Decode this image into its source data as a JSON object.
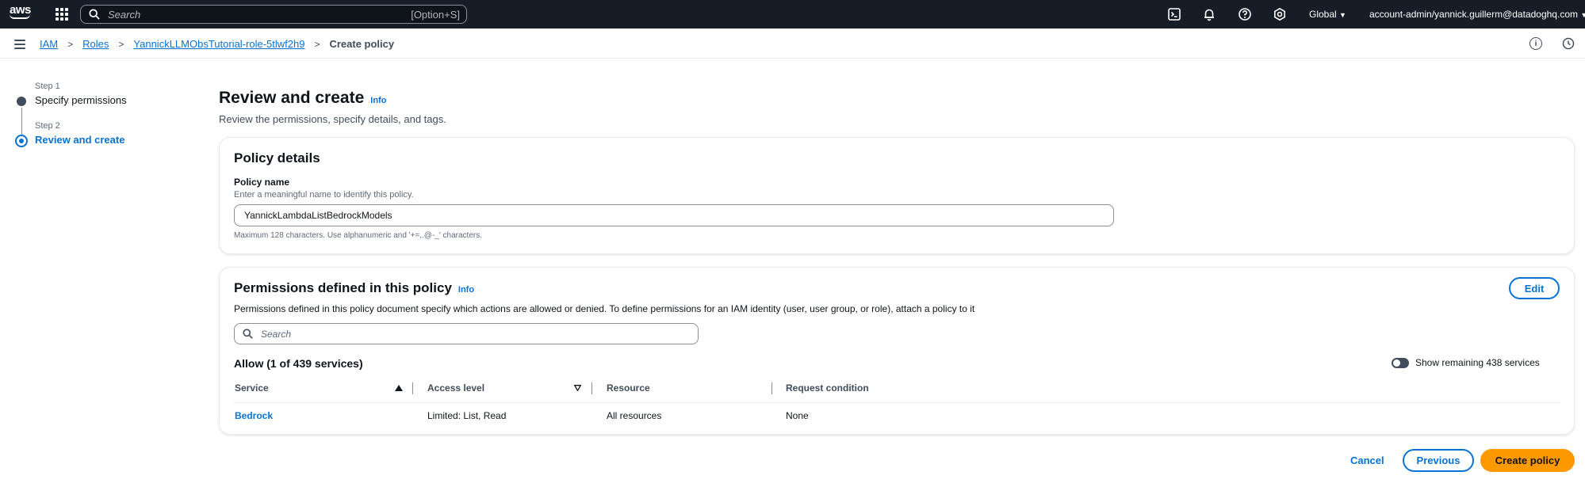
{
  "topnav": {
    "logo_text": "aws",
    "search_placeholder": "Search",
    "search_shortcut": "[Option+S]",
    "region": "Global",
    "region_caret": "▼",
    "account": "account-admin/yannick.guillerm@datadoghq.com",
    "account_caret": "▼",
    "icons": [
      "cloudshell-icon",
      "bell-icon",
      "help-icon",
      "settings-icon"
    ]
  },
  "breadcrumb": {
    "items": [
      "IAM",
      "Roles",
      "YannickLLMObsTutorial-role-5tlwf2h9"
    ],
    "current": "Create policy",
    "separator": ">",
    "right_icons": [
      "info-icon",
      "history-icon"
    ]
  },
  "steps": [
    {
      "step_label": "Step 1",
      "title": "Specify permissions",
      "active": false
    },
    {
      "step_label": "Step 2",
      "title": "Review and create",
      "active": true
    }
  ],
  "main": {
    "title": "Review and create",
    "info": "Info",
    "description": "Review the permissions, specify details, and tags."
  },
  "policy_details": {
    "title": "Policy details",
    "name_label": "Policy name",
    "name_hint": "Enter a meaningful name to identify this policy.",
    "name_value": "YannickLambdaListBedrockModels",
    "name_constraint": "Maximum 128 characters. Use alphanumeric and '+=,.@-_' characters."
  },
  "permissions": {
    "title": "Permissions defined in this policy",
    "info": "Info",
    "description": "Permissions defined in this policy document specify which actions are allowed or denied. To define permissions for an IAM identity (user, user group, or role), attach a policy to it",
    "edit_label": "Edit",
    "search_placeholder": "Search",
    "allow_title": "Allow (1 of 439 services)",
    "toggle_label": "Show remaining 438 services",
    "toggle_on": false,
    "columns": [
      "Service",
      "Access level",
      "Resource",
      "Request condition"
    ],
    "rows": [
      {
        "service": "Bedrock",
        "access_level": "Limited: List, Read",
        "resource": "All resources",
        "request_condition": "None"
      }
    ]
  },
  "footer": {
    "cancel": "Cancel",
    "previous": "Previous",
    "create": "Create policy"
  },
  "colors": {
    "nav_bg": "#161d26",
    "link": "#0972d3",
    "primary_button": "#ff9900"
  }
}
